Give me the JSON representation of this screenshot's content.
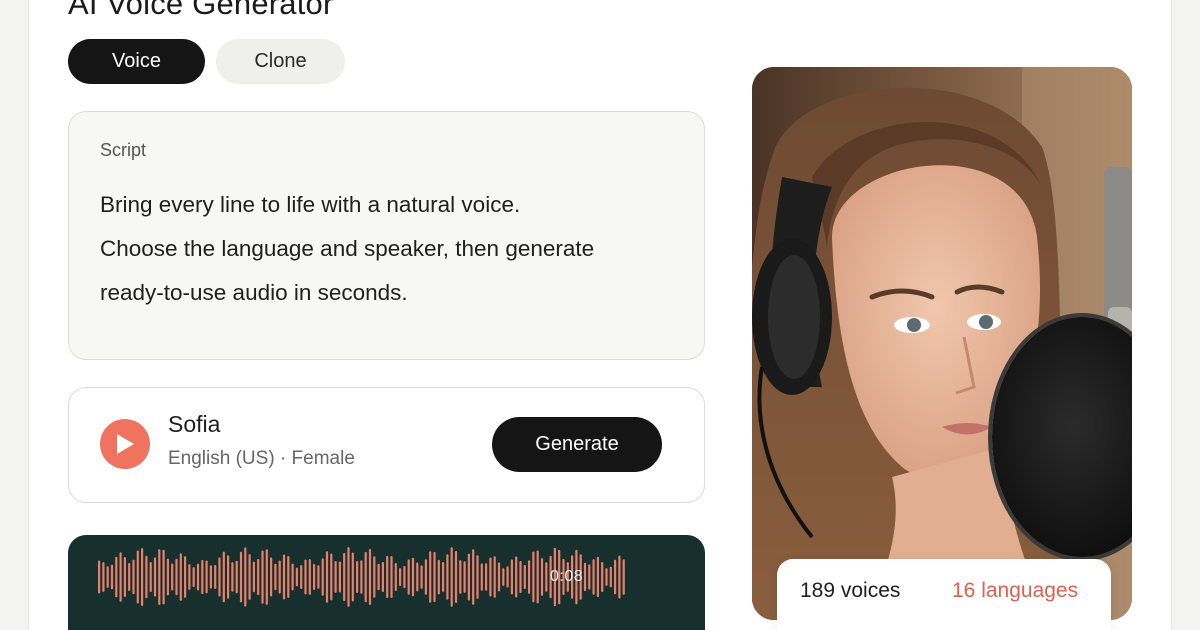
{
  "app": {
    "title": "AI Voice Generator",
    "accent_color": "#f07360",
    "dark_color": "#151515",
    "wave_bg_color": "#17302e"
  },
  "tabs": [
    {
      "label": "Voice",
      "active": true
    },
    {
      "label": "Clone",
      "active": false
    }
  ],
  "script": {
    "label": "Script",
    "lines": [
      "Bring every line to life with a natural voice.",
      "Choose the language and speaker, then generate",
      "ready-to-use audio in seconds."
    ]
  },
  "voice": {
    "name": "Sofia",
    "meta": "English (US) · Female",
    "play_icon": "play-icon",
    "generate_label": "Generate"
  },
  "waveform": {
    "time": "0:08",
    "bar_color": "#e8806c"
  },
  "photo": {
    "alt_icon": "person-with-headphones-and-microphone"
  },
  "stats": {
    "voices": "189 voices",
    "languages": "16 languages"
  }
}
